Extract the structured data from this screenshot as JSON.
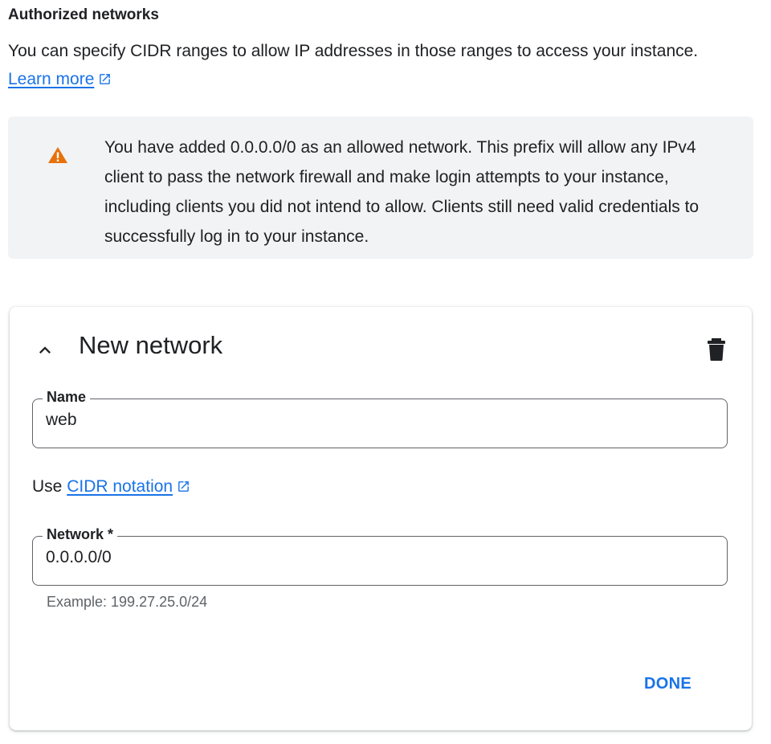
{
  "section": {
    "title": "Authorized networks",
    "description": "You can specify CIDR ranges to allow IP addresses in those ranges to access your instance.",
    "learn_more": "Learn more"
  },
  "warning": {
    "icon": "warning-triangle-icon",
    "text": "You have added 0.0.0.0/0 as an allowed network. This prefix will allow any IPv4 client to pass the network firewall and make login attempts to your instance, including clients you did not intend to allow. Clients still need valid credentials to successfully log in to your instance."
  },
  "card": {
    "title": "New network",
    "name_field": {
      "label": "Name",
      "value": "web"
    },
    "cidr_prefix": "Use",
    "cidr_link": "CIDR notation",
    "network_field": {
      "label": "Network *",
      "value": "0.0.0.0/0",
      "hint": "Example: 199.27.25.0/24"
    },
    "done_label": "DONE"
  },
  "colors": {
    "link": "#1a73e8",
    "warning_icon": "#e8710a",
    "warning_bg": "#f1f3f4"
  }
}
